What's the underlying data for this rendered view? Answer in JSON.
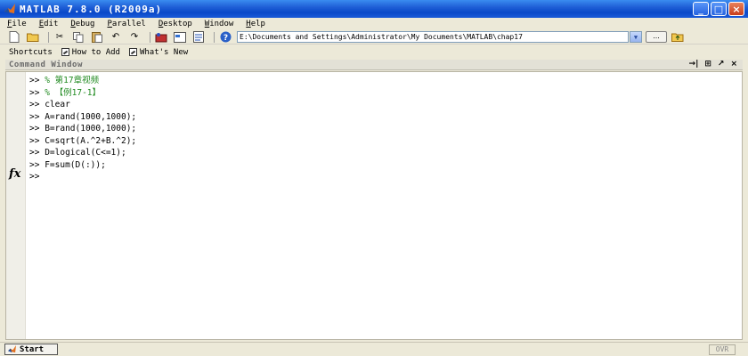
{
  "window": {
    "title": "MATLAB  7.8.0  (R2009a)",
    "minimize_label": "_",
    "maximize_label": "□",
    "close_label": "×"
  },
  "menu": [
    "File",
    "Edit",
    "Debug",
    "Parallel",
    "Desktop",
    "Window",
    "Help"
  ],
  "toolbar": {
    "current_folder_path": "E:\\Documents and Settings\\Administrator\\My Documents\\MATLAB\\chap17",
    "browse_label": "..."
  },
  "shortcuts": {
    "shortcuts_label": "Shortcuts",
    "how_to_add_label": "How to Add",
    "whats_new_label": "What's New"
  },
  "command_window": {
    "title": "Command Window",
    "lines": [
      {
        "prompt": ">>",
        "text": "% 第17章视频",
        "type": "comment"
      },
      {
        "prompt": ">>",
        "text": "% 【例17-1】",
        "type": "comment"
      },
      {
        "prompt": ">>",
        "text": "clear",
        "type": "code"
      },
      {
        "prompt": ">>",
        "text": "A=rand(1000,1000);",
        "type": "code"
      },
      {
        "prompt": ">>",
        "text": "B=rand(1000,1000);",
        "type": "code"
      },
      {
        "prompt": ">>",
        "text": "C=sqrt(A.^2+B.^2);",
        "type": "code"
      },
      {
        "prompt": ">>",
        "text": "D=logical(C<=1);",
        "type": "code"
      },
      {
        "prompt": ">>",
        "text": "F=sum(D(:));",
        "type": "code"
      },
      {
        "prompt": ">>",
        "text": "",
        "type": "code"
      }
    ],
    "fx_label": "fx"
  },
  "status": {
    "start_label": "Start",
    "ovr_label": "OVR"
  },
  "colors": {
    "comment": "#228b22",
    "titlebar": "#0a49c9"
  }
}
